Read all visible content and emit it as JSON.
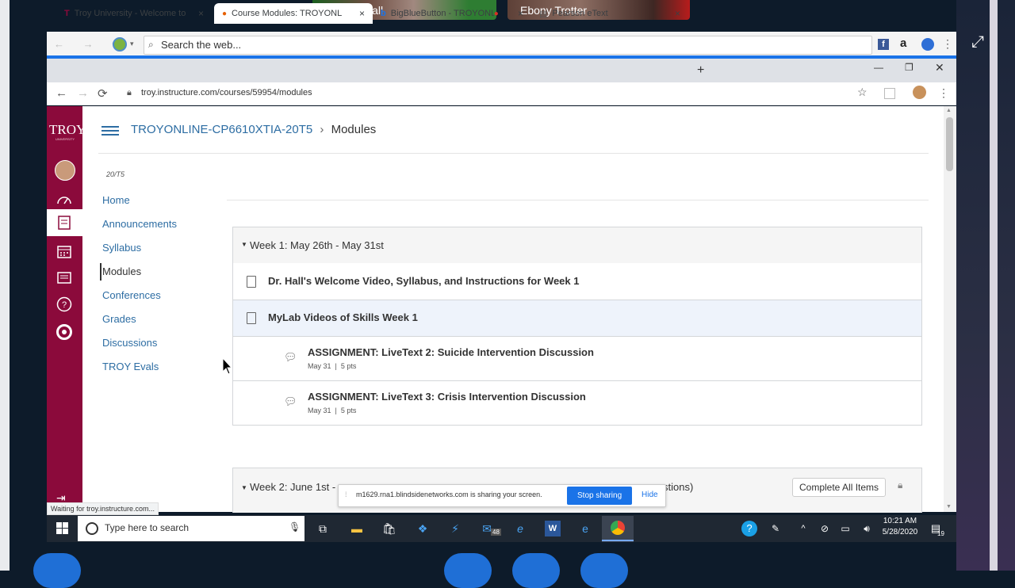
{
  "meeting": {
    "participants": [
      {
        "name": "Tabitha Hall"
      },
      {
        "name": "Ebony Trotter"
      }
    ]
  },
  "browser": {
    "search_placeholder": "Search the web...",
    "tabs": [
      {
        "label": "Troy University - Welcome to My",
        "close": "×"
      },
      {
        "label": "Course Modules: TROYONLINE Fa",
        "close": "×"
      },
      {
        "label": "BigBlueButton - TROYONLINE",
        "close": "×"
      },
      {
        "label": "Pearson eText",
        "close": "×"
      }
    ],
    "new_tab": "+",
    "url": "troy.instructure.com/courses/59954/modules",
    "status": "Waiting for troy.instructure.com..."
  },
  "canvas": {
    "logo_text": "TROY",
    "logo_sub": "UNIVERSITY",
    "breadcrumb": {
      "course": "TROYONLINE-CP6610XTIA-20T5",
      "separator": "›",
      "current": "Modules"
    },
    "term": "20/T5",
    "nav": [
      "Home",
      "Announcements",
      "Syllabus",
      "Modules",
      "Conferences",
      "Grades",
      "Discussions",
      "TROY Evals"
    ],
    "modules": [
      {
        "title": "Week 1: May 26th - May 31st",
        "items": [
          {
            "title": "Dr. Hall's Welcome Video, Syllabus, and Instructions for Week 1"
          },
          {
            "title": "MyLab Videos of Skills Week 1"
          },
          {
            "title": "ASSIGNMENT: LiveText 2: Suicide Intervention Discussion",
            "meta": "May 31  |  5 pts"
          },
          {
            "title": "ASSIGNMENT: LiveText 3: Crisis Intervention Discussion",
            "meta": "May 31  |  5 pts"
          }
        ]
      },
      {
        "title": "Week 2: June 1st -",
        "title_tail": "stions)",
        "complete_button": "Complete All Items"
      }
    ]
  },
  "share_banner": {
    "text": "m1629.rna1.blindsidenetworks.com is sharing your screen.",
    "stop": "Stop sharing",
    "hide": "Hide"
  },
  "taskbar": {
    "search_placeholder": "Type here to search",
    "mail_badge": "48",
    "time": "10:21 AM",
    "date": "5/28/2020",
    "notif_count": "19"
  }
}
